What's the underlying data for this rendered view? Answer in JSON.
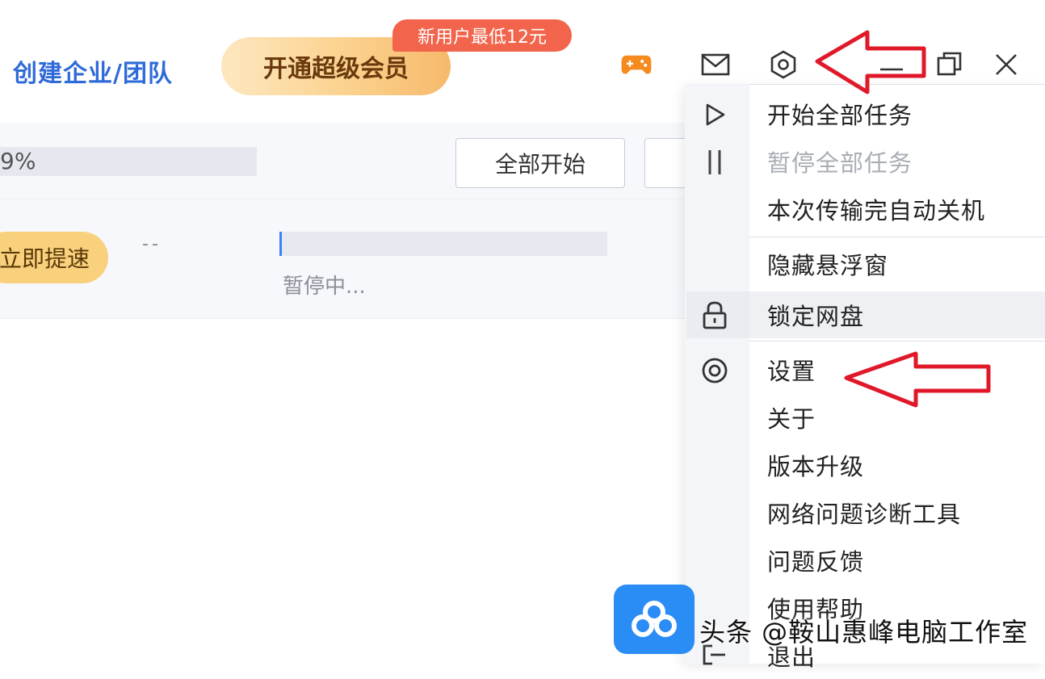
{
  "header": {
    "create_team": "创建企业/团队",
    "vip_button": "开通超级会员",
    "promo_badge": "新用户最低12元"
  },
  "toolbar": {
    "total_percent": "9%",
    "start_all": "全部开始"
  },
  "task": {
    "speedup": "立即提速",
    "speed": "--",
    "status": "暂停中..."
  },
  "menu": {
    "items": [
      {
        "label": "开始全部任务",
        "icon": "play-icon"
      },
      {
        "label": "暂停全部任务",
        "icon": "pause-icon",
        "disabled": true
      },
      {
        "label": "本次传输完自动关机"
      },
      {
        "label": "隐藏悬浮窗"
      },
      {
        "label": "锁定网盘",
        "icon": "lock-icon",
        "highlighted": true
      },
      {
        "label": "设置",
        "icon": "settings-icon"
      },
      {
        "label": "关于"
      },
      {
        "label": "版本升级"
      },
      {
        "label": "网络问题诊断工具"
      },
      {
        "label": "问题反馈"
      },
      {
        "label": "使用帮助"
      },
      {
        "label": "退出",
        "icon": "logout-icon"
      }
    ]
  },
  "watermark": "头条 @鞍山惠峰电脑工作室",
  "colors": {
    "brand_blue": "#2f6bd8",
    "vip_gold": "#fbd28e",
    "promo_red": "#f2654c",
    "annotation_red": "#e0192a"
  }
}
